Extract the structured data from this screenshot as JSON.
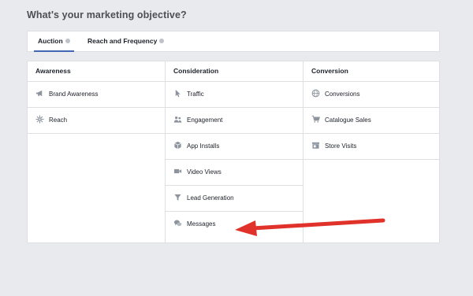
{
  "page": {
    "title": "What's your marketing objective?"
  },
  "tabs": [
    {
      "label": "Auction"
    },
    {
      "label": "Reach and Frequency"
    }
  ],
  "columns": [
    {
      "header": "Awareness",
      "items": [
        {
          "label": "Brand Awareness",
          "icon": "megaphone-icon"
        },
        {
          "label": "Reach",
          "icon": "reach-burst-icon"
        }
      ]
    },
    {
      "header": "Consideration",
      "items": [
        {
          "label": "Traffic",
          "icon": "cursor-icon"
        },
        {
          "label": "Engagement",
          "icon": "people-icon"
        },
        {
          "label": "App Installs",
          "icon": "box-icon"
        },
        {
          "label": "Video Views",
          "icon": "video-camera-icon"
        },
        {
          "label": "Lead Generation",
          "icon": "funnel-icon"
        },
        {
          "label": "Messages",
          "icon": "chat-bubbles-icon"
        }
      ]
    },
    {
      "header": "Conversion",
      "items": [
        {
          "label": "Conversions",
          "icon": "globe-icon"
        },
        {
          "label": "Catalogue Sales",
          "icon": "cart-icon"
        },
        {
          "label": "Store Visits",
          "icon": "store-icon"
        }
      ]
    }
  ],
  "colors": {
    "accent": "#4267b2",
    "icon": "#8d949e",
    "arrow": "#e0322b"
  }
}
